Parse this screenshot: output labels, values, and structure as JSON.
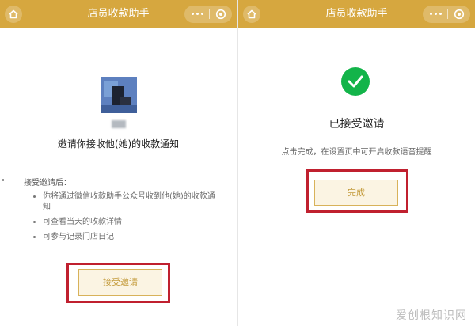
{
  "app_title": "店员收款助手",
  "left_panel": {
    "invite_heading": "邀请你接收他(她)的收款通知",
    "after_accept_label": "接受邀请后：",
    "bullets": [
      "你将通过微信收款助手公众号收到他(她)的收款通知",
      "可查看当天的收款详情",
      "可参与记录门店日记"
    ],
    "accept_button": "接受邀请"
  },
  "right_panel": {
    "accepted_title": "已接受邀请",
    "hint": "点击完成，在设置页中可开启收款语音提醒",
    "done_button": "完成"
  },
  "watermark": "爱创根知识网",
  "colors": {
    "titlebar": "#d6a73f",
    "button_text": "#c39a3a",
    "highlight": "#c0202f",
    "check": "#13b44a"
  },
  "icons": [
    "home-icon",
    "more-dots-icon",
    "close-target-icon",
    "check-icon"
  ]
}
